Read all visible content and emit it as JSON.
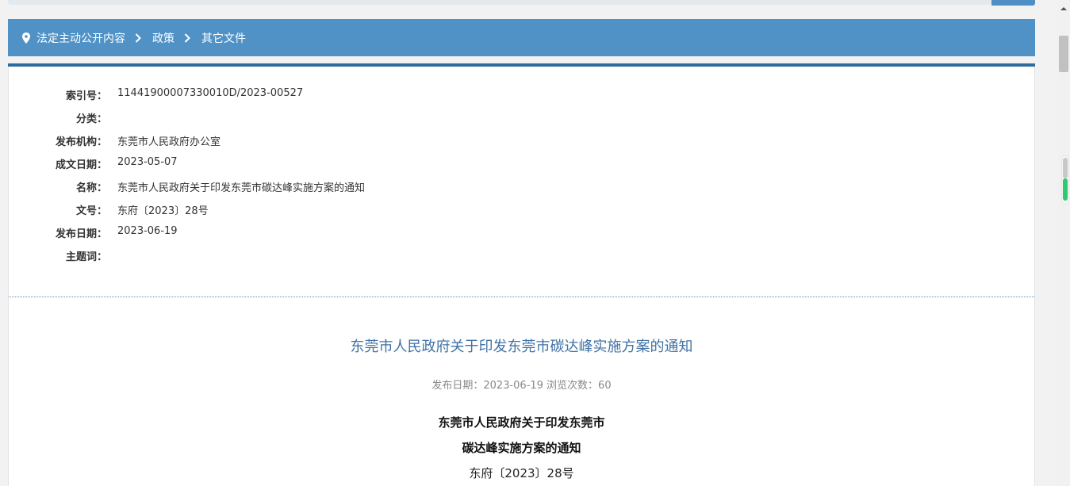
{
  "breadcrumb": {
    "items": [
      "法定主动公开内容",
      "政策",
      "其它文件"
    ]
  },
  "meta": [
    {
      "label": "索引号：",
      "value": "11441900007330010D/2023-00527"
    },
    {
      "label": "分类：",
      "value": ""
    },
    {
      "label": "发布机构：",
      "value": "东莞市人民政府办公室"
    },
    {
      "label": "成文日期：",
      "value": "2023-05-07"
    },
    {
      "label": "名称：",
      "value": "东莞市人民政府关于印发东莞市碳达峰实施方案的通知"
    },
    {
      "label": "文号：",
      "value": "东府〔2023〕28号"
    },
    {
      "label": "发布日期：",
      "value": "2023-06-19"
    },
    {
      "label": "主题词：",
      "value": ""
    }
  ],
  "document": {
    "title": "东莞市人民政府关于印发东莞市碳达峰实施方案的通知",
    "info": "发布日期：2023-06-19  浏览次数：60",
    "heading_line1": "东莞市人民政府关于印发东莞市",
    "heading_line2": "碳达峰实施方案的通知",
    "number": "东府〔2023〕28号"
  },
  "colors": {
    "breadcrumb_bg": "#5092c6",
    "title_blue": "#3f72a6",
    "reading_progress": "#2ec970"
  },
  "icons": {
    "location": "location-pin-icon",
    "separator": "chevron-right-icon"
  }
}
